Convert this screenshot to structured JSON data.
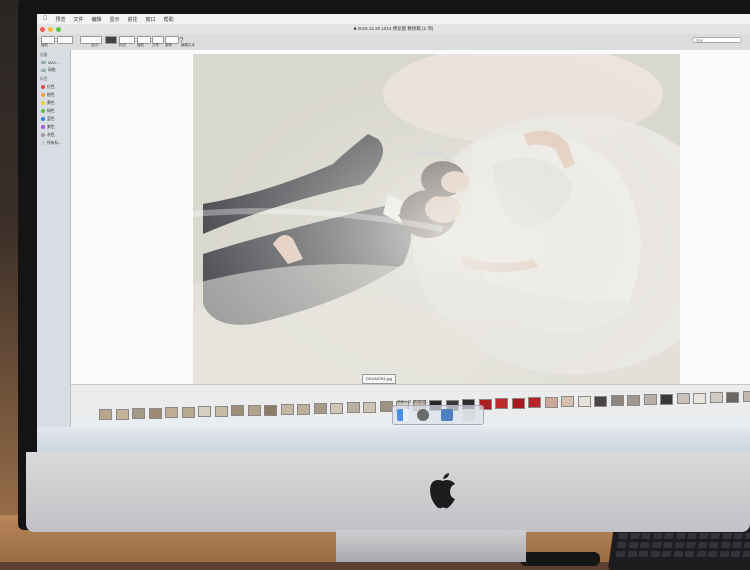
{
  "menubar": {
    "items": [
      "预览",
      "文件",
      "编辑",
      "显示",
      "前往",
      "窗口",
      "帮助"
    ],
    "status": ""
  },
  "window": {
    "title": "■ 2016.12.20 1014 预览图 精修稿 (2 项)"
  },
  "toolbar": {
    "labels": [
      "缩放",
      "显示",
      "标记",
      "缩放",
      "共享",
      "旋转",
      "编辑文本"
    ],
    "search_placeholder": "搜索",
    "help_glyph": "?"
  },
  "sidebar": {
    "section_devices": "设备",
    "devices": [
      "MAC…",
      "网络"
    ],
    "section_tags": "标签",
    "tags": [
      {
        "label": "红色",
        "color": "#e24b4b"
      },
      {
        "label": "橙色",
        "color": "#f0a23a"
      },
      {
        "label": "黄色",
        "color": "#e7cf3b"
      },
      {
        "label": "绿色",
        "color": "#5bbf4a"
      },
      {
        "label": "蓝色",
        "color": "#3c7de0"
      },
      {
        "label": "紫色",
        "color": "#a25ad1"
      },
      {
        "label": "灰色",
        "color": "#9a9a9a"
      },
      {
        "label": "所有标…",
        "color": "#cccccc"
      }
    ]
  },
  "viewer": {
    "filename_tooltip": "DD1A0781.jpg"
  },
  "filmstrip": {
    "status_text": "选择 1 项 (共 81 项)",
    "thumb_colors": [
      "#b9a58a",
      "#c2b49a",
      "#a49987",
      "#9c8a72",
      "#bfae92",
      "#b7a98f",
      "#d7cfc0",
      "#c9bca5",
      "#9e8f7b",
      "#b2a48d",
      "#8c7d6a",
      "#c5b8a3",
      "#bcb09c",
      "#a69a87",
      "#d1c7b8",
      "#b9b0a0",
      "#ccc3b3",
      "#9d9282",
      "#d8d2c6",
      "#bfb5a5",
      "#262626",
      "#3a3a3a",
      "#2e2e2e",
      "#b01c22",
      "#c0262b",
      "#a51a1f",
      "#b5252a",
      "#caa99a",
      "#d8c0b0",
      "#e5e0d8",
      "#4a4444",
      "#8e8680",
      "#a09890",
      "#b8b0a8",
      "#3a3636",
      "#c9c1b9",
      "#e9e5df",
      "#d2cbc3",
      "#6d6560",
      "#c1b9b1"
    ]
  },
  "dock": {
    "icons": [
      "finder-icon",
      "system-preferences-icon",
      "preview-icon",
      "trash-icon"
    ]
  }
}
